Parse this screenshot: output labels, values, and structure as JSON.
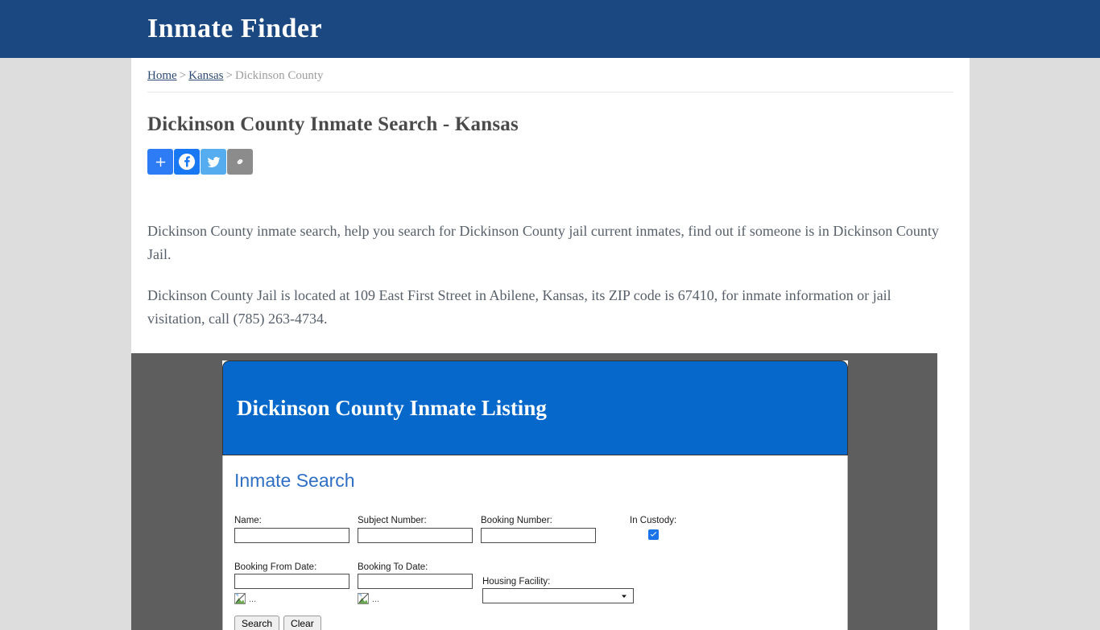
{
  "header": {
    "site_title": "Inmate Finder",
    "bar_color": "#1c4881"
  },
  "breadcrumb": {
    "home": "Home",
    "state": "Kansas",
    "current": "Dickinson County",
    "separator": ">"
  },
  "page": {
    "title": "Dickinson County Inmate Search - Kansas"
  },
  "share": {
    "buttons": [
      {
        "name": "addthis-share-button",
        "icon": "plus-icon",
        "color": "#2e7bf6",
        "label": "Share"
      },
      {
        "name": "facebook-share-button",
        "icon": "facebook-icon",
        "color": "#1877f2",
        "label": "Facebook"
      },
      {
        "name": "twitter-share-button",
        "icon": "twitter-icon",
        "color": "#55acee",
        "label": "Twitter"
      },
      {
        "name": "copy-link-button",
        "icon": "link-icon",
        "color": "#8c8c8c",
        "label": "Copy Link"
      }
    ]
  },
  "body": {
    "paragraph_1": "Dickinson County inmate search, help you search for Dickinson County jail current inmates, find out if someone is in Dickinson County Jail.",
    "paragraph_2": "Dickinson County Jail is located at 109 East First Street in Abilene, Kansas, its ZIP code is 67410, for inmate information or jail visitation, call (785) 263-4734."
  },
  "listing": {
    "banner_title": "Dickinson County Inmate Listing",
    "banner_color": "#0668cb",
    "frame_background": "#5e5e5e",
    "search_heading": "Inmate Search",
    "fields": {
      "name_label": "Name:",
      "name_value": "",
      "subject_number_label": "Subject Number:",
      "subject_number_value": "",
      "booking_number_label": "Booking Number:",
      "booking_number_value": "",
      "in_custody_label": "In Custody:",
      "in_custody_checked": true,
      "booking_from_label": "Booking From Date:",
      "booking_from_value": "",
      "booking_to_label": "Booking To Date:",
      "booking_to_value": "",
      "housing_facility_label": "Housing Facility:",
      "housing_facility_value": "",
      "broken_image_alt": "..."
    },
    "buttons": {
      "search": "Search",
      "clear": "Clear"
    }
  }
}
